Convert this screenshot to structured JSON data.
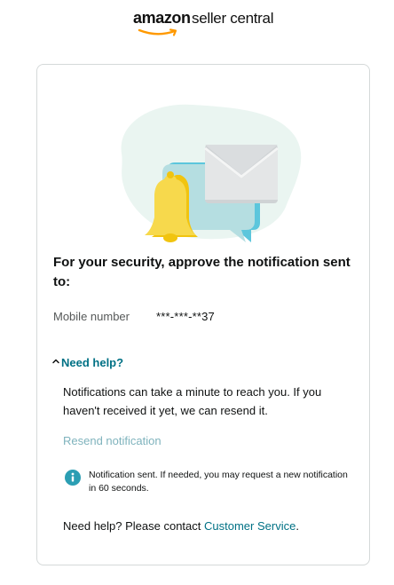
{
  "brand": {
    "logo_word_1": "amazon",
    "logo_word_2": "seller central"
  },
  "challenge": {
    "title": "For your security, approve the notification sent to:",
    "mobile_label": "Mobile number",
    "mobile_value": "***-***-**37"
  },
  "help": {
    "toggle_label": "Need help?",
    "text": "Notifications can take a minute to reach you. If you haven't received it yet, we can resend it.",
    "resend_label": "Resend notification",
    "alert_text": "Notification sent. If needed, you may request a new notification in 60 seconds.",
    "contact_prefix": "Need help? Please contact ",
    "contact_link": "Customer Service",
    "contact_suffix": "."
  },
  "icons": {
    "logo_smile": "amazon-smile-icon",
    "hero": "notification-illustration",
    "caret": "chevron-up-icon",
    "alert": "info-icon"
  },
  "colors": {
    "link": "#007185",
    "resend_disabled": "#7fb3bd",
    "info_icon": "#2b9eb3",
    "bell": "#f7d94c",
    "card_border": "#d5d9d9"
  }
}
